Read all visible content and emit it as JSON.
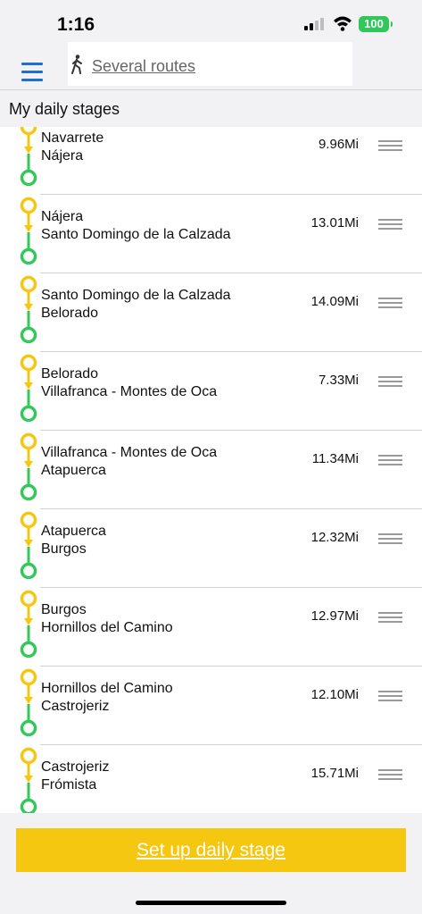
{
  "status_bar": {
    "time": "1:16",
    "battery": "100"
  },
  "header": {
    "route_label": "Several routes"
  },
  "section_title": "My daily stages",
  "stages": [
    {
      "from": "Navarrete",
      "to": "Nájera",
      "distance": "9.96Mi"
    },
    {
      "from": "Nájera",
      "to": "Santo Domingo de la Calzada",
      "distance": "13.01Mi"
    },
    {
      "from": "Santo Domingo de la Calzada",
      "to": "Belorado",
      "distance": "14.09Mi"
    },
    {
      "from": "Belorado",
      "to": "Villafranca - Montes de Oca",
      "distance": "7.33Mi"
    },
    {
      "from": "Villafranca - Montes de Oca",
      "to": "Atapuerca",
      "distance": "11.34Mi"
    },
    {
      "from": "Atapuerca",
      "to": "Burgos",
      "distance": "12.32Mi"
    },
    {
      "from": "Burgos",
      "to": "Hornillos del Camino",
      "distance": "12.97Mi"
    },
    {
      "from": "Hornillos del Camino",
      "to": "Castrojeriz",
      "distance": "12.10Mi"
    },
    {
      "from": "Castrojeriz",
      "to": "Frómista",
      "distance": "15.71Mi"
    }
  ],
  "setup_button_label": "Set up daily stage",
  "colors": {
    "accent_blue": "#1f6fd1",
    "start_yellow": "#f5c710",
    "end_green": "#34c759",
    "button_yellow": "#f5c710"
  }
}
